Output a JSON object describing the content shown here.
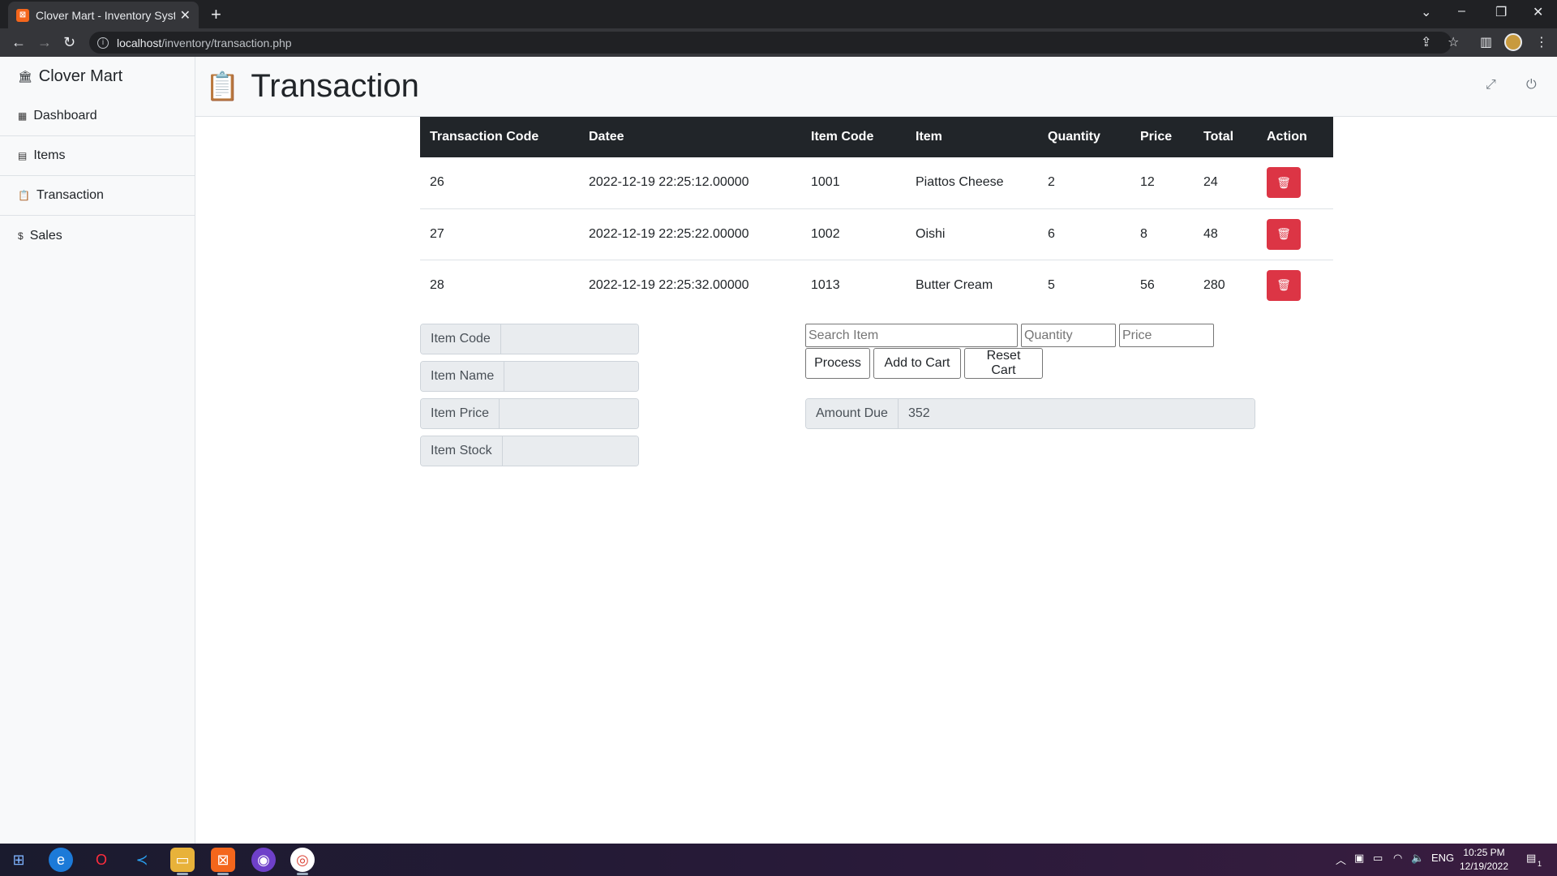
{
  "browser": {
    "tab_title": "Clover Mart - Inventory System",
    "favicon": "xampp-icon",
    "url_host": "localhost",
    "url_path": "/inventory/transaction.php"
  },
  "sidebar": {
    "brand": "Clover Mart",
    "items": [
      {
        "label": "Dashboard",
        "icon": "grid-icon"
      },
      {
        "label": "Items",
        "icon": "calculator-icon"
      },
      {
        "label": "Transaction",
        "icon": "clipboard-icon"
      },
      {
        "label": "Sales",
        "icon": "dollar-icon"
      }
    ]
  },
  "header": {
    "title": "Transaction",
    "icon": "clipboard-icon"
  },
  "table": {
    "headers": [
      "Transaction Code",
      "Datee",
      "Item Code",
      "Item",
      "Quantity",
      "Price",
      "Total",
      "Action"
    ],
    "rows": [
      {
        "code": "26",
        "date": "2022-12-19 22:25:12.00000",
        "item_code": "1001",
        "item": "Piattos Cheese",
        "qty": "2",
        "price": "12",
        "total": "24"
      },
      {
        "code": "27",
        "date": "2022-12-19 22:25:22.00000",
        "item_code": "1002",
        "item": "Oishi",
        "qty": "6",
        "price": "8",
        "total": "48"
      },
      {
        "code": "28",
        "date": "2022-12-19 22:25:32.00000",
        "item_code": "1013",
        "item": "Butter Cream",
        "qty": "5",
        "price": "56",
        "total": "280"
      }
    ]
  },
  "item_info": {
    "code_label": "Item Code",
    "name_label": "Item Name",
    "price_label": "Item Price",
    "stock_label": "Item Stock"
  },
  "cart": {
    "search_placeholder": "Search Item",
    "quantity_placeholder": "Quantity",
    "price_placeholder": "Price",
    "process_label": "Process",
    "add_label": "Add to Cart",
    "reset_label": "Reset Cart",
    "amount_due_label": "Amount Due",
    "amount_due_value": "352"
  },
  "taskbar": {
    "lang": "ENG",
    "time": "10:25 PM",
    "date": "12/19/2022",
    "notification_count": "1"
  },
  "colors": {
    "danger": "#dc3545",
    "table_header": "#212529",
    "sidebar_bg": "#f8f9fa"
  }
}
